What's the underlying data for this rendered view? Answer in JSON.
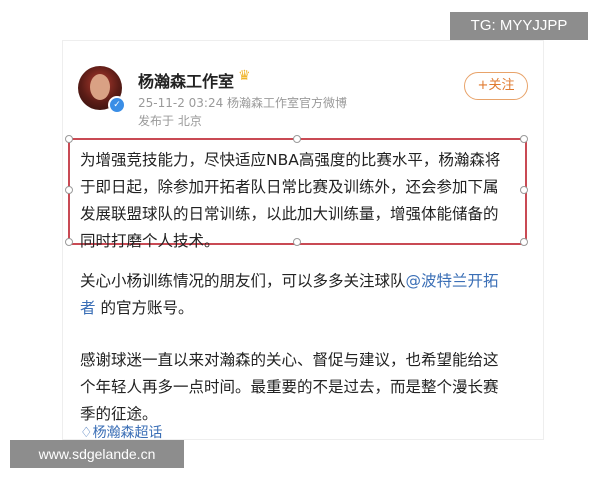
{
  "watermarks": {
    "top": "TG: MYYJJPP",
    "bottom": "www.sdgelande.cn"
  },
  "post": {
    "author": "杨瀚森工作室",
    "meta_line": "25-11-2 03:24  杨瀚森工作室官方微博",
    "location": "发布于 北京",
    "follow_label": "+关注",
    "paragraph1": "为增强竞技能力，尽快适应NBA高强度的比赛水平，杨瀚森将于即日起，除参加开拓者队日常比赛及训练外，还会参加下属发展联盟球队的日常训练，以此加大训练量，增强体能储备的同时打磨个人技术。",
    "paragraph2_prefix": "关心小杨训练情况的朋友们，可以多多关注球队",
    "paragraph2_link": "@波特兰开拓者",
    "paragraph2_suffix": " 的官方账号。",
    "paragraph3": "感谢球迷一直以来对瀚森的关心、督促与建议，也希望能给这个年轻人再多一点时间。最重要的不是过去，而是整个漫长赛季的征途。",
    "topic": "杨瀚森超话"
  },
  "icons": {
    "crown": "crown-icon",
    "verified": "verified-badge-icon",
    "topic": "diamond-topic-icon"
  },
  "colors": {
    "accent_orange": "#e07a2f",
    "selection_red": "#c94a54",
    "link_blue": "#3b6fb6"
  }
}
